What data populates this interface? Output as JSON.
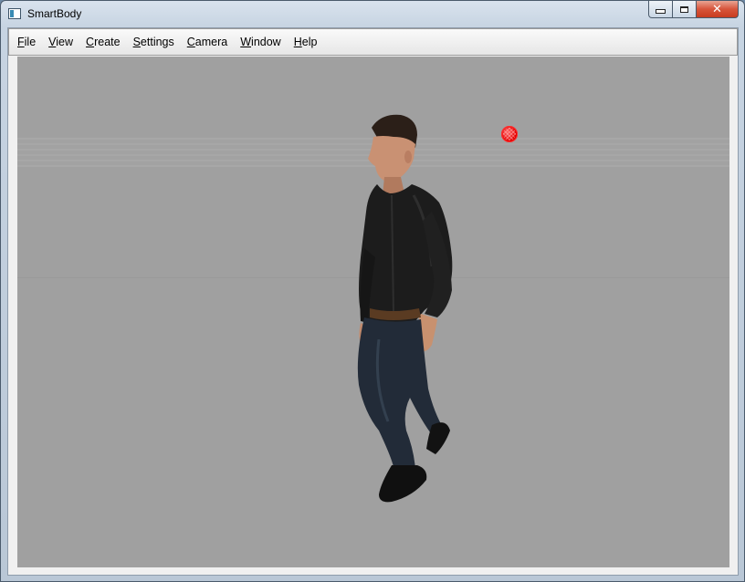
{
  "window": {
    "title": "SmartBody",
    "icon": "app-window-icon",
    "caption_buttons": {
      "minimize_icon": "minimize-icon",
      "maximize_icon": "maximize-icon",
      "close_label": "✕"
    }
  },
  "menubar": {
    "items": [
      {
        "label": "File",
        "mnemonic": "F"
      },
      {
        "label": "View",
        "mnemonic": "V"
      },
      {
        "label": "Create",
        "mnemonic": "C"
      },
      {
        "label": "Settings",
        "mnemonic": "S"
      },
      {
        "label": "Camera",
        "mnemonic": "C"
      },
      {
        "label": "Window",
        "mnemonic": "W"
      },
      {
        "label": "Help",
        "mnemonic": "H"
      }
    ]
  },
  "viewport": {
    "background": "#a0a0a0",
    "objects": [
      {
        "kind": "character",
        "description": "walking-man-character"
      },
      {
        "kind": "target",
        "color": "#e50000"
      }
    ]
  }
}
